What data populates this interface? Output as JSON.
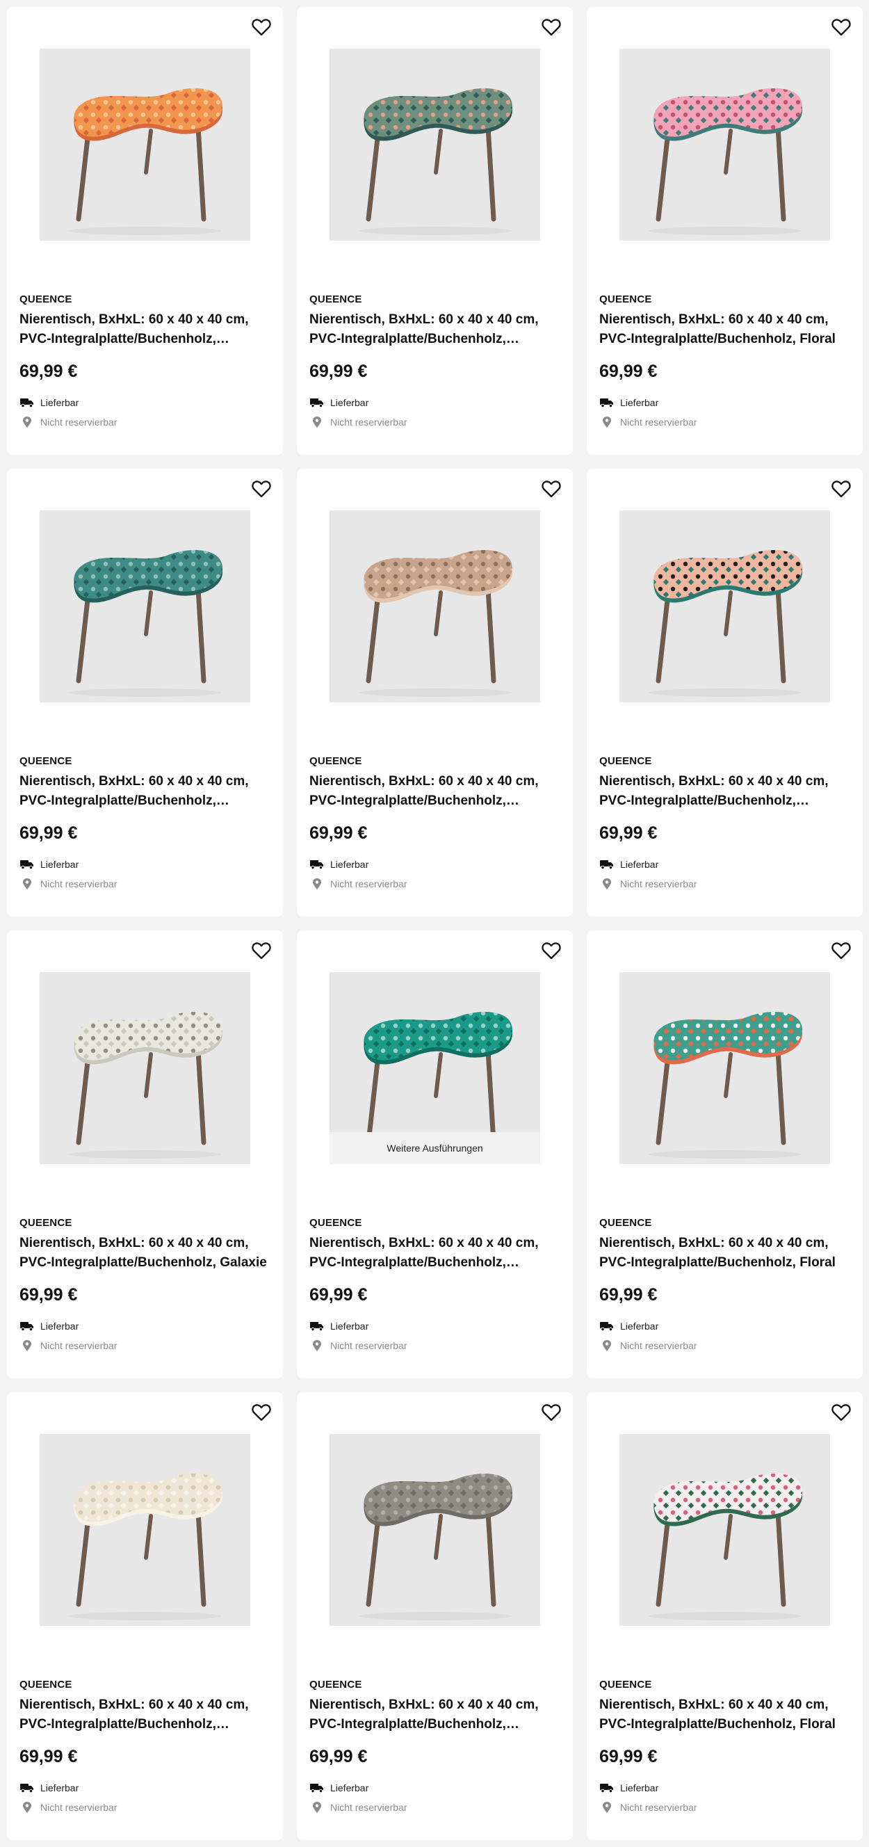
{
  "products": [
    {
      "brand": "QUEENCE",
      "title": "Nierentisch, BxHxL: 60 x 40 x 40 cm, PVC-Integralplatte/Buchenholz,…",
      "price": "69,99 €",
      "delivery": "Lieferbar",
      "reservation": "Nicht reservierbar",
      "colors": [
        "#f2954e",
        "#f7c590",
        "#d8683a"
      ]
    },
    {
      "brand": "QUEENCE",
      "title": "Nierentisch, BxHxL: 60 x 40 x 40 cm, PVC-Integralplatte/Buchenholz,…",
      "price": "69,99 €",
      "delivery": "Lieferbar",
      "reservation": "Nicht reservierbar",
      "colors": [
        "#6c8f7e",
        "#e49f88",
        "#2f5a56"
      ]
    },
    {
      "brand": "QUEENCE",
      "title": "Nierentisch, BxHxL: 60 x 40 x 40 cm, PVC-Integralplatte/Buchenholz, Floral",
      "price": "69,99 €",
      "delivery": "Lieferbar",
      "reservation": "Nicht reservierbar",
      "colors": [
        "#f1a3b8",
        "#c0536f",
        "#3f7c79"
      ]
    },
    {
      "brand": "QUEENCE",
      "title": "Nierentisch, BxHxL: 60 x 40 x 40 cm, PVC-Integralplatte/Buchenholz,…",
      "price": "69,99 €",
      "delivery": "Lieferbar",
      "reservation": "Nicht reservierbar",
      "colors": [
        "#3f8c86",
        "#8fc2b5",
        "#24605c"
      ]
    },
    {
      "brand": "QUEENCE",
      "title": "Nierentisch, BxHxL: 60 x 40 x 40 cm, PVC-Integralplatte/Buchenholz,…",
      "price": "69,99 €",
      "delivery": "Lieferbar",
      "reservation": "Nicht reservierbar",
      "colors": [
        "#c9a48c",
        "#8d6f5c",
        "#e2c6b1"
      ]
    },
    {
      "brand": "QUEENCE",
      "title": "Nierentisch, BxHxL: 60 x 40 x 40 cm, PVC-Integralplatte/Buchenholz,…",
      "price": "69,99 €",
      "delivery": "Lieferbar",
      "reservation": "Nicht reservierbar",
      "colors": [
        "#f0b7a0",
        "#1f1f1f",
        "#2b7a72"
      ]
    },
    {
      "brand": "QUEENCE",
      "title": "Nierentisch, BxHxL: 60 x 40 x 40 cm, PVC-Integralplatte/Buchenholz, Galaxie",
      "price": "69,99 €",
      "delivery": "Lieferbar",
      "reservation": "Nicht reservierbar",
      "colors": [
        "#e8e8df",
        "#8d8f86",
        "#c9c9be"
      ]
    },
    {
      "brand": "QUEENCE",
      "title": "Nierentisch, BxHxL: 60 x 40 x 40 cm, PVC-Integralplatte/Buchenholz,…",
      "price": "69,99 €",
      "delivery": "Lieferbar",
      "reservation": "Nicht reservierbar",
      "more": "Weitere Ausführungen",
      "colors": [
        "#1b9a87",
        "#9ad6c8",
        "#0f6f60"
      ]
    },
    {
      "brand": "QUEENCE",
      "title": "Nierentisch, BxHxL: 60 x 40 x 40 cm, PVC-Integralplatte/Buchenholz, Floral",
      "price": "69,99 €",
      "delivery": "Lieferbar",
      "reservation": "Nicht reservierbar",
      "colors": [
        "#3f9e8c",
        "#e9f2ee",
        "#e06a4a"
      ]
    },
    {
      "brand": "QUEENCE",
      "title": "Nierentisch, BxHxL: 60 x 40 x 40 cm, PVC-Integralplatte/Buchenholz,…",
      "price": "69,99 €",
      "delivery": "Lieferbar",
      "reservation": "Nicht reservierbar",
      "colors": [
        "#efe6d6",
        "#d9c9ae",
        "#f7f1e6"
      ]
    },
    {
      "brand": "QUEENCE",
      "title": "Nierentisch, BxHxL: 60 x 40 x 40 cm, PVC-Integralplatte/Buchenholz,…",
      "price": "69,99 €",
      "delivery": "Lieferbar",
      "reservation": "Nicht reservierbar",
      "colors": [
        "#8f8c84",
        "#b1aea6",
        "#6f6c66"
      ]
    },
    {
      "brand": "QUEENCE",
      "title": "Nierentisch, BxHxL: 60 x 40 x 40 cm, PVC-Integralplatte/Buchenholz, Floral",
      "price": "69,99 €",
      "delivery": "Lieferbar",
      "reservation": "Nicht reservierbar",
      "colors": [
        "#f5eef0",
        "#d8627b",
        "#2f6b4f"
      ]
    }
  ]
}
